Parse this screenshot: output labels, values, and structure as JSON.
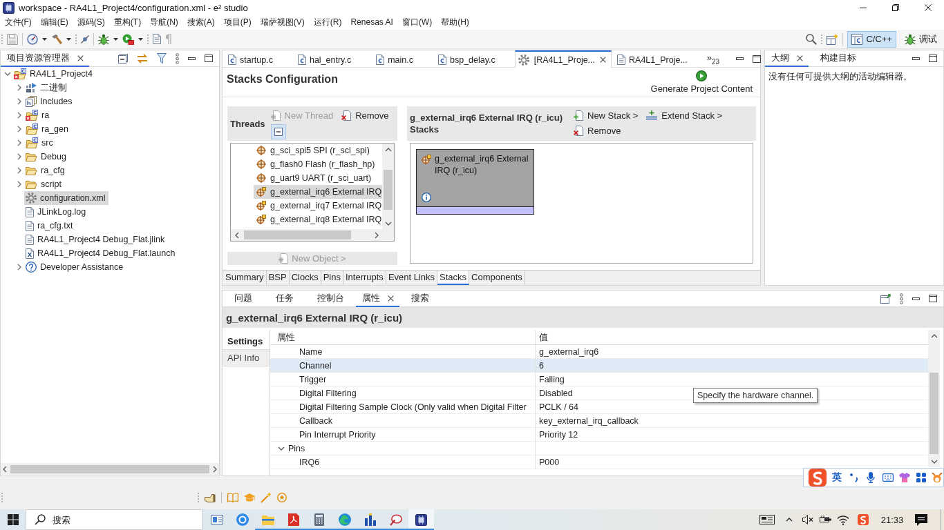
{
  "window": {
    "title": "workspace - RA4L1_Project4/configuration.xml - e² studio"
  },
  "menu": [
    "文件(F)",
    "编辑(E)",
    "源码(S)",
    "重构(T)",
    "导航(N)",
    "搜索(A)",
    "项目(P)",
    "瑞萨视图(V)",
    "运行(R)",
    "Renesas AI",
    "窗口(W)",
    "帮助(H)"
  ],
  "perspectives": [
    {
      "label": "C/C++",
      "kind": "cpp",
      "selected": true
    },
    {
      "label": "调试",
      "kind": "debug",
      "selected": false
    }
  ],
  "project_explorer": {
    "tab": {
      "label": "项目资源管理器",
      "selected": true
    },
    "tree": [
      {
        "label": "RA4L1_Project4",
        "kind": "project",
        "expanded": true,
        "selected": false,
        "children": [
          {
            "label": "二进制",
            "kind": "binaries",
            "expanded": false,
            "selected": false
          },
          {
            "label": "Includes",
            "kind": "includes",
            "expanded": false,
            "selected": false
          },
          {
            "label": "ra",
            "kind": "source-folder-error",
            "expanded": false,
            "selected": false
          },
          {
            "label": "ra_gen",
            "kind": "source-folder",
            "expanded": false,
            "selected": false
          },
          {
            "label": "src",
            "kind": "source-folder",
            "expanded": false,
            "selected": false
          },
          {
            "label": "Debug",
            "kind": "folder",
            "expanded": false,
            "selected": false
          },
          {
            "label": "ra_cfg",
            "kind": "folder",
            "expanded": false,
            "selected": false
          },
          {
            "label": "script",
            "kind": "folder",
            "expanded": false,
            "selected": false
          },
          {
            "label": "configuration.xml",
            "kind": "config",
            "selected": true
          },
          {
            "label": "JLinkLog.log",
            "kind": "text",
            "selected": false
          },
          {
            "label": "ra_cfg.txt",
            "kind": "text",
            "selected": false
          },
          {
            "label": "RA4L1_Project4 Debug_Flat.jlink",
            "kind": "text",
            "selected": false
          },
          {
            "label": "RA4L1_Project4 Debug_Flat.launch",
            "kind": "launch",
            "selected": false
          },
          {
            "label": "Developer Assistance",
            "kind": "help",
            "expanded": false,
            "selected": false
          }
        ]
      }
    ]
  },
  "editor": {
    "tabs": [
      {
        "label": "startup.c",
        "kind": "c-file",
        "selected": false
      },
      {
        "label": "hal_entry.c",
        "kind": "c-file",
        "selected": false
      },
      {
        "label": "main.c",
        "kind": "c-file",
        "selected": false
      },
      {
        "label": "bsp_delay.c",
        "kind": "c-file",
        "selected": false
      },
      {
        "label": "[RA4L1_Proje...",
        "kind": "config",
        "selected": true
      },
      {
        "label": "RA4L1_Proje...",
        "kind": "text",
        "selected": false
      }
    ],
    "overflow": {
      "label": "»",
      "count": "23"
    },
    "title": "Stacks Configuration",
    "generate": "Generate Project Content",
    "threads": {
      "label": "Threads",
      "actions": [
        {
          "label": "New Thread",
          "kind": "new",
          "disabled": true
        },
        {
          "label": "Remove",
          "kind": "remove",
          "disabled": false
        }
      ],
      "items": [
        {
          "label": "g_sci_spi5 SPI (r_sci_spi)",
          "kind": "module",
          "selected": false
        },
        {
          "label": "g_flash0 Flash (r_flash_hp)",
          "kind": "module",
          "selected": false
        },
        {
          "label": "g_uart9 UART (r_sci_uart)",
          "kind": "module",
          "selected": false
        },
        {
          "label": "g_external_irq6 External IRQ",
          "kind": "irq",
          "selected": true
        },
        {
          "label": "g_external_irq7 External IRQ",
          "kind": "irq",
          "selected": false
        },
        {
          "label": "g_external_irq8 External IRQ",
          "kind": "irq",
          "selected": false
        }
      ],
      "new_object": {
        "label": "New Object >",
        "disabled": true
      }
    },
    "stacks": {
      "title": "g_external_irq6 External IRQ (r_icu)",
      "subtitle": "Stacks",
      "actions": [
        {
          "label": "New Stack >",
          "kind": "new",
          "disabled": false
        },
        {
          "label": "Extend Stack >",
          "kind": "extend",
          "disabled": false
        },
        {
          "label": "Remove",
          "kind": "remove",
          "disabled": false
        }
      ],
      "blocks": [
        {
          "label": "g_external_irq6 External IRQ (r_icu)",
          "kind": "irq"
        }
      ]
    },
    "pages": [
      {
        "label": "Summary",
        "selected": false
      },
      {
        "label": "BSP",
        "selected": false
      },
      {
        "label": "Clocks",
        "selected": false
      },
      {
        "label": "Pins",
        "selected": false
      },
      {
        "label": "Interrupts",
        "selected": false
      },
      {
        "label": "Event Links",
        "selected": false
      },
      {
        "label": "Stacks",
        "selected": true
      },
      {
        "label": "Components",
        "selected": false
      }
    ]
  },
  "outline": {
    "tabs": [
      {
        "label": "大纲",
        "selected": true
      },
      {
        "label": "构建目标",
        "selected": false
      }
    ],
    "message": "没有任何可提供大纲的活动编辑器。"
  },
  "properties_view": {
    "tabs": [
      {
        "label": "问题",
        "selected": false
      },
      {
        "label": "任务",
        "selected": false
      },
      {
        "label": "控制台",
        "selected": false
      },
      {
        "label": "属性",
        "selected": true
      },
      {
        "label": "搜索",
        "selected": false
      }
    ],
    "title": "g_external_irq6 External IRQ (r_icu)",
    "side_tabs": [
      {
        "label": "Settings",
        "selected": true
      },
      {
        "label": "API Info",
        "selected": false
      }
    ],
    "columns": [
      "属性",
      "值"
    ],
    "rows": [
      {
        "name": "Name",
        "value": "g_external_irq6",
        "kind": "property",
        "selected": false
      },
      {
        "name": "Channel",
        "value": "6",
        "kind": "property",
        "selected": true
      },
      {
        "name": "Trigger",
        "value": "Falling",
        "kind": "property",
        "selected": false
      },
      {
        "name": "Digital Filtering",
        "value": "Disabled",
        "kind": "property",
        "selected": false
      },
      {
        "name": "Digital Filtering Sample Clock (Only valid when Digital Filter",
        "value": "PCLK / 64",
        "kind": "property",
        "selected": false
      },
      {
        "name": "Callback",
        "value": "key_external_irq_callback",
        "kind": "property",
        "selected": false
      },
      {
        "name": "Pin Interrupt Priority",
        "value": "Priority 12",
        "kind": "property",
        "selected": false
      },
      {
        "name": "Pins",
        "kind": "group",
        "expanded": true,
        "selected": false,
        "children": [
          {
            "name": "IRQ6",
            "value": "P000",
            "kind": "property",
            "selected": false
          }
        ]
      }
    ],
    "tooltip": "Specify the hardware channel."
  },
  "ime": {
    "mode": "英"
  },
  "taskbar": {
    "search": {
      "placeholder": "搜索"
    },
    "apps": [
      {
        "kind": "news",
        "selected": false,
        "running": false
      },
      {
        "kind": "k-app",
        "selected": false,
        "running": false
      },
      {
        "kind": "explorer",
        "selected": false,
        "running": true
      },
      {
        "kind": "pdf",
        "selected": false,
        "running": true
      },
      {
        "kind": "calculator",
        "selected": false,
        "running": true
      },
      {
        "kind": "edge",
        "selected": false,
        "running": true
      },
      {
        "kind": "chart",
        "selected": false,
        "running": true
      },
      {
        "kind": "pen",
        "selected": false,
        "running": true
      },
      {
        "kind": "chip",
        "selected": true,
        "running": true
      }
    ],
    "time": "21:33"
  }
}
